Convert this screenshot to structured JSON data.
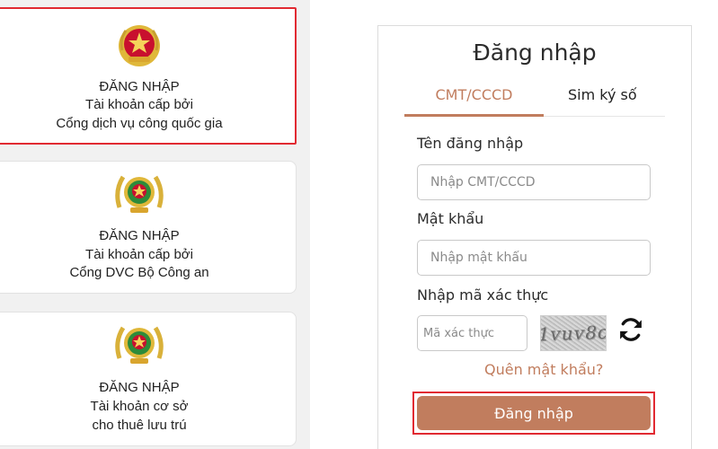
{
  "login_options": [
    {
      "lines": [
        "ĐĂNG NHẬP",
        "Tài khoản cấp bởi",
        "Cổng dịch vụ công quốc gia"
      ],
      "emblem": "national-emblem-icon",
      "selected": true
    },
    {
      "lines": [
        "ĐĂNG NHẬP",
        "Tài khoản cấp bởi",
        "Cổng DVC Bộ Công an"
      ],
      "emblem": "police-emblem-icon",
      "selected": false
    },
    {
      "lines": [
        "ĐĂNG NHẬP",
        "Tài khoản cơ sở",
        "cho thuê lưu trú"
      ],
      "emblem": "police-emblem-icon",
      "selected": false
    }
  ],
  "form": {
    "title": "Đăng nhập",
    "tabs": [
      {
        "label": "CMT/CCCD",
        "active": true
      },
      {
        "label": "Sim ký số",
        "active": false
      }
    ],
    "username": {
      "label": "Tên đăng nhập",
      "placeholder": "Nhập CMT/CCCD",
      "value": ""
    },
    "password": {
      "label": "Mật khẩu",
      "placeholder": "Nhập mật khẩu",
      "value": ""
    },
    "captcha": {
      "label": "Nhập mã xác thực",
      "placeholder": "Mã xác thực",
      "value": "",
      "image_text": "1vuv8c"
    },
    "forgot_label": "Quên mật khẩu?",
    "submit_label": "Đăng nhập"
  },
  "colors": {
    "accent": "#c17d5e",
    "highlight": "#e12a32",
    "emblem_red": "#c8102e",
    "emblem_gold": "#e0b83a",
    "police_green": "#2e8b3a"
  }
}
